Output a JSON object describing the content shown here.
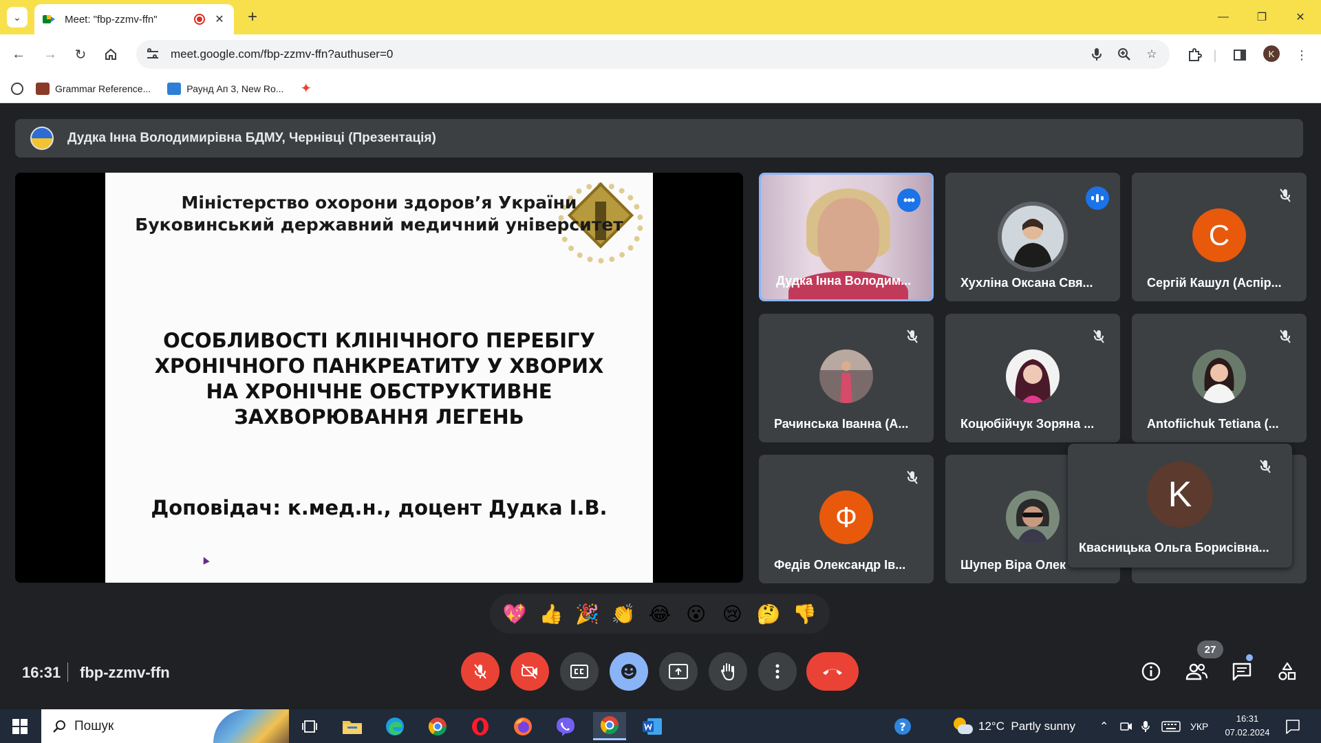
{
  "browser": {
    "tab_title": "Meet: \"fbp-zzmv-ffn\"",
    "new_tab": "+",
    "url": "meet.google.com/fbp-zzmv-ffn?authuser=0",
    "profile_initial": "K",
    "bookmarks": [
      {
        "label": "Grammar Reference..."
      },
      {
        "label": "Раунд Ап 3, New Ro..."
      }
    ]
  },
  "meet": {
    "presenter_label": "Дудка Інна Володимирівна БДМУ, Чернівці (Презентація)",
    "slide": {
      "heading_line1": "Міністерство охорони здоров’я України",
      "heading_line2": "Буковинський державний медичний університет",
      "title_line1": "ОСОБЛИВОСТІ КЛІНІЧНОГО ПЕРЕБІГУ",
      "title_line2": "ХРОНІЧНОГО ПАНКРЕАТИТУ У ХВОРИХ",
      "title_line3": "НА ХРОНІЧНЕ ОБСТРУКТИВНЕ",
      "title_line4": "ЗАХВОРЮВАННЯ ЛЕГЕНЬ",
      "speaker": "Доповідач: к.мед.н., доцент Дудка І.В."
    },
    "participants": [
      {
        "name": "Дудка Інна Володим...",
        "status": "more-options"
      },
      {
        "name": "Хухліна Оксана Свя...",
        "status": "speaking"
      },
      {
        "name": "Сергій Кашул (Аспір...",
        "initial": "С",
        "color": "#e8590c",
        "status": "muted"
      },
      {
        "name": "Рачинська Іванна (А...",
        "status": "muted"
      },
      {
        "name": "Коцюбійчук Зоряна ...",
        "status": "muted"
      },
      {
        "name": "Antofiichuk Tetiana (...",
        "status": "muted"
      },
      {
        "name": "Федів Олександр Ів...",
        "initial": "Ф",
        "color": "#e8590c",
        "status": "muted"
      },
      {
        "name": "Шупер Віра Олек",
        "status": "muted"
      }
    ],
    "self": {
      "name": "Квасницька Ольга Борисівна...",
      "initial": "K",
      "color": "#5c3a2e"
    },
    "reactions": [
      "💖",
      "👍",
      "🎉",
      "👏",
      "😂",
      "😮",
      "😢",
      "🤔",
      "👎"
    ],
    "time": "16:31",
    "meeting_code": "fbp-zzmv-ffn",
    "people_count": "27"
  },
  "taskbar": {
    "search_placeholder": "Пошук",
    "weather": "12°C  Partly sunny",
    "language": "УКР",
    "time": "16:31",
    "date": "07.02.2024"
  }
}
